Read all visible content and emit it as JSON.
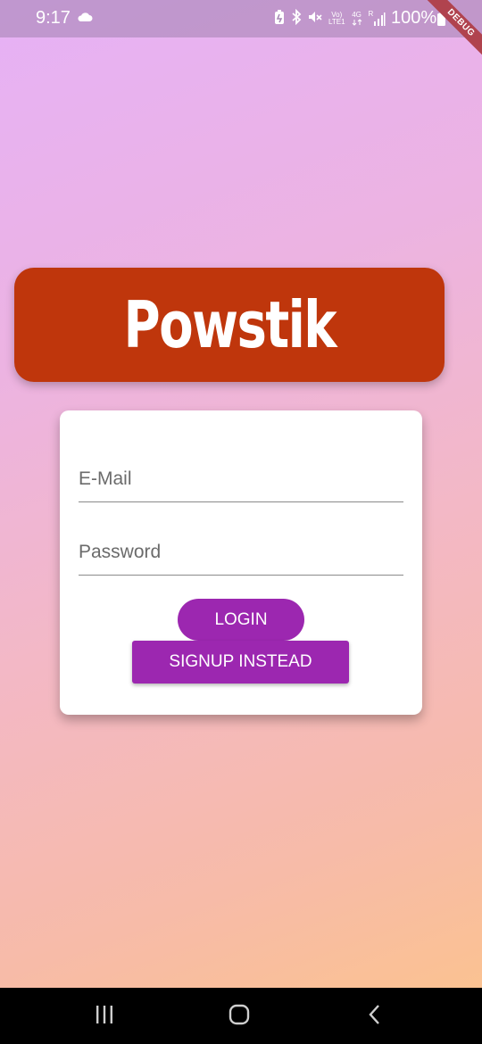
{
  "status_bar": {
    "time": "9:17",
    "battery": "100%",
    "volte_label_top": "Vo)",
    "volte_label_bottom": "LTE1",
    "network_label": "4G",
    "signal_label": "R",
    "icons": [
      "cloud-icon",
      "battery-saver-icon",
      "bluetooth-icon",
      "mute-icon",
      "volte-icon",
      "network-4g-icon",
      "signal-icon",
      "battery-icon"
    ]
  },
  "debug_banner": "DEBUG",
  "app": {
    "title": "Powstik"
  },
  "auth_form": {
    "email_placeholder": "E-Mail",
    "password_placeholder": "Password",
    "login_label": "LOGIN",
    "signup_label": "SIGNUP INSTEAD"
  },
  "nav_bar": {
    "icons": [
      "recents-icon",
      "home-icon",
      "back-icon"
    ]
  },
  "colors": {
    "title_banner": "#bf360c",
    "button": "#9c27b0",
    "gradient_top": "#e6b1f6",
    "gradient_bottom": "#fcc48b"
  }
}
